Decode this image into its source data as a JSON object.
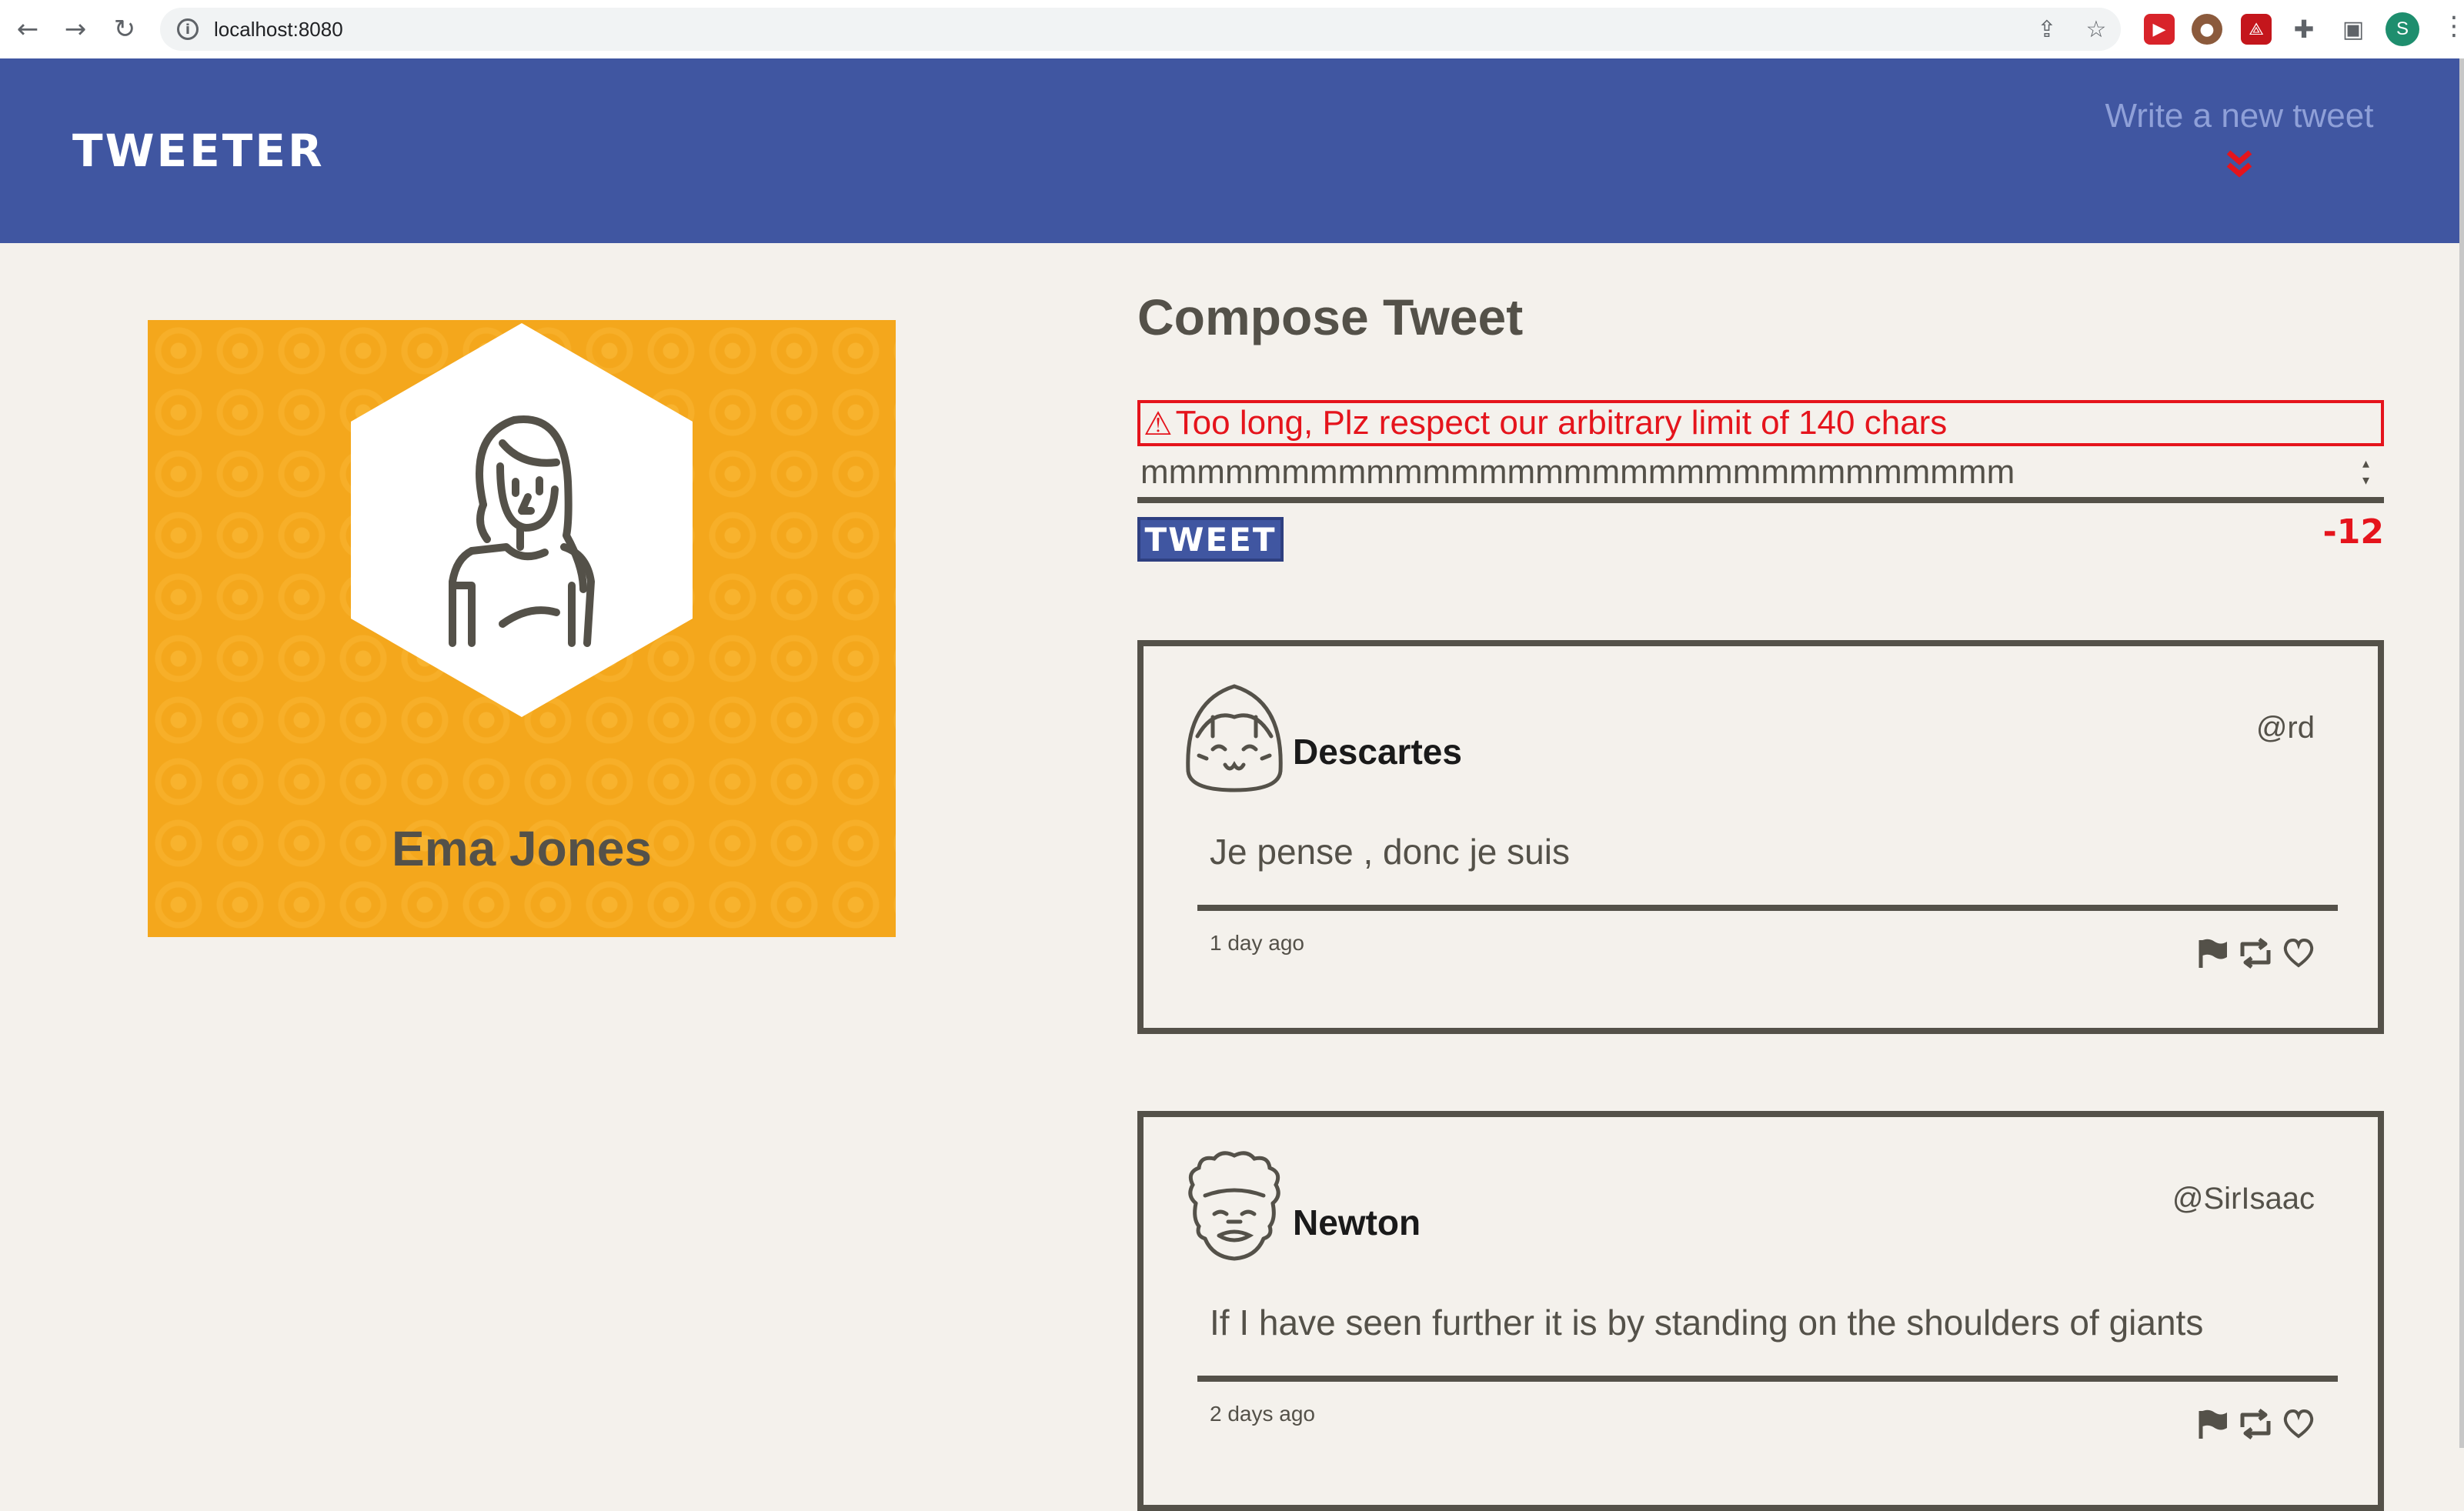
{
  "browser": {
    "url": "localhost:8080",
    "profile_initial": "S"
  },
  "header": {
    "logo": "TWEETER",
    "write_link": "Write a new tweet",
    "write_arrow": "❯❯"
  },
  "profile": {
    "name": "Ema Jones"
  },
  "compose": {
    "title": "Compose Tweet",
    "error": "Too long, Plz respect our arbitrary limit of 140 chars",
    "input_value": "mmmmmmmmmmmmmmmmmmmmmmmmmmmmmmm",
    "button": "TWEET",
    "counter": "-12"
  },
  "tweets": [
    {
      "name": "Descartes",
      "handle": "@rd",
      "text": "Je pense , donc je suis",
      "time": "1 day ago"
    },
    {
      "name": "Newton",
      "handle": "@SirIsaac",
      "text": "If I have seen further it is by standing on the shoulders of giants",
      "time": "2 days ago"
    }
  ],
  "colors": {
    "header": "#4056a1",
    "accent": "#e5141c",
    "card": "#f4a71c",
    "text": "#545149"
  }
}
